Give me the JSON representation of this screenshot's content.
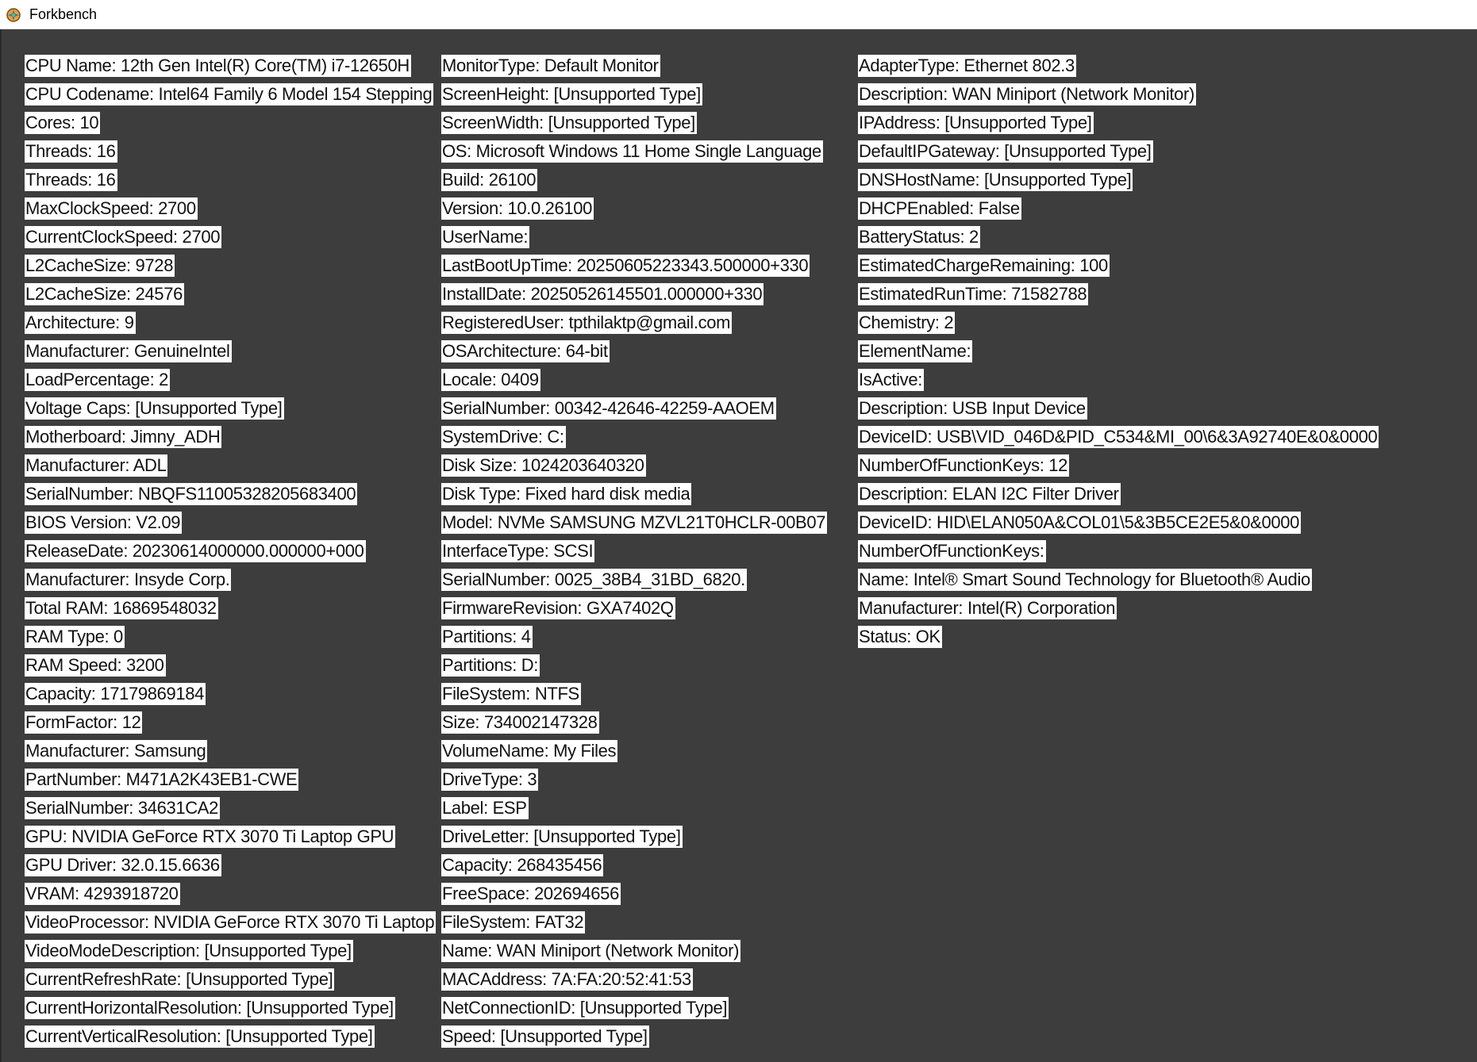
{
  "window": {
    "title": "Forkbench",
    "icon": "forkbench-app-icon"
  },
  "columns": [
    [
      "CPU Name: 12th Gen Intel(R) Core(TM) i7-12650H",
      "CPU Codename: Intel64 Family 6 Model 154 Stepping",
      "Cores: 10",
      "Threads: 16",
      "Threads: 16",
      "MaxClockSpeed: 2700",
      "CurrentClockSpeed: 2700",
      "L2CacheSize: 9728",
      "L2CacheSize: 24576",
      "Architecture: 9",
      "Manufacturer: GenuineIntel",
      "LoadPercentage: 2",
      "Voltage Caps: [Unsupported Type]",
      "Motherboard: Jimny_ADH",
      "Manufacturer: ADL",
      "SerialNumber: NBQFS11005328205683400",
      "BIOS Version: V2.09",
      "ReleaseDate: 20230614000000.000000+000",
      "Manufacturer: Insyde Corp.",
      "Total RAM: 16869548032",
      "RAM Type: 0",
      "RAM Speed: 3200",
      "Capacity: 17179869184",
      "FormFactor: 12",
      "Manufacturer: Samsung",
      "PartNumber: M471A2K43EB1-CWE    ",
      "SerialNumber: 34631CA2",
      "GPU: NVIDIA GeForce RTX 3070 Ti Laptop GPU",
      "GPU Driver: 32.0.15.6636",
      "VRAM: 4293918720",
      "VideoProcessor: NVIDIA GeForce RTX 3070 Ti Laptop",
      "VideoModeDescription: [Unsupported Type]",
      "CurrentRefreshRate: [Unsupported Type]",
      "CurrentHorizontalResolution: [Unsupported Type]",
      "CurrentVerticalResolution: [Unsupported Type]"
    ],
    [
      "MonitorType: Default Monitor",
      "ScreenHeight: [Unsupported Type]",
      "ScreenWidth: [Unsupported Type]",
      "OS: Microsoft Windows 11 Home Single Language",
      "Build: 26100",
      "Version: 10.0.26100",
      "UserName: ",
      "LastBootUpTime: 20250605223343.500000+330",
      "InstallDate: 20250526145501.000000+330",
      "RegisteredUser: tpthilaktp@gmail.com",
      "OSArchitecture: 64-bit",
      "Locale: 0409",
      "SerialNumber: 00342-42646-42259-AAOEM",
      "SystemDrive: C:",
      "Disk Size: 1024203640320",
      "Disk Type: Fixed hard disk media",
      "Model: NVMe SAMSUNG MZVL21T0HCLR-00B07",
      "InterfaceType: SCSI",
      "SerialNumber: 0025_38B4_31BD_6820.",
      "FirmwareRevision: GXA7402Q",
      "Partitions: 4",
      "Partitions: D:",
      "FileSystem: NTFS",
      "Size: 734002147328",
      "VolumeName: My Files",
      "DriveType: 3",
      "Label: ESP",
      "DriveLetter: [Unsupported Type]",
      "Capacity: 268435456",
      "FreeSpace: 202694656",
      "FileSystem: FAT32",
      "Name: WAN Miniport (Network Monitor)",
      "MACAddress: 7A:FA:20:52:41:53",
      "NetConnectionID: [Unsupported Type]",
      "Speed: [Unsupported Type]"
    ],
    [
      "AdapterType: Ethernet 802.3",
      "Description: WAN Miniport (Network Monitor)",
      "IPAddress: [Unsupported Type]",
      "DefaultIPGateway: [Unsupported Type]",
      "DNSHostName: [Unsupported Type]",
      "DHCPEnabled: False",
      "BatteryStatus: 2",
      "EstimatedChargeRemaining: 100",
      "EstimatedRunTime: 71582788",
      "Chemistry: 2",
      "ElementName: ",
      "IsActive: ",
      "Description: USB Input Device",
      "DeviceID: USB\\VID_046D&PID_C534&MI_00\\6&3A92740E&0&0000",
      "NumberOfFunctionKeys: 12",
      "Description: ELAN I2C Filter Driver",
      "DeviceID: HID\\ELAN050A&COL01\\5&3B5CE2E5&0&0000",
      "NumberOfFunctionKeys: ",
      "Name: Intel® Smart Sound Technology for Bluetooth® Audio",
      "Manufacturer: Intel(R) Corporation",
      "Status: OK"
    ]
  ]
}
